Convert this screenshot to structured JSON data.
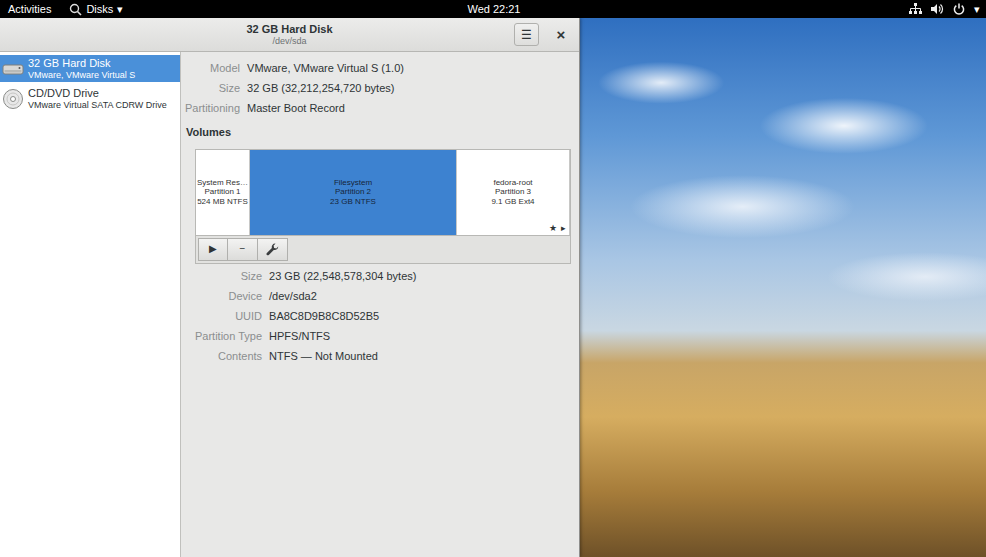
{
  "top_bar": {
    "activities": "Activities",
    "app_menu": {
      "label": "Disks",
      "arrow": "▾"
    },
    "clock": "Wed 22:21",
    "system_menu_arrow": "▾"
  },
  "window": {
    "title": "32 GB Hard Disk",
    "subtitle": "/dev/sda",
    "menu_button": "☰",
    "close_button": "×"
  },
  "sidebar": {
    "items": [
      {
        "title": "32 GB Hard Disk",
        "subtitle": "VMware, VMware Virtual S",
        "kind": "disk",
        "selected": true
      },
      {
        "title": "CD/DVD Drive",
        "subtitle": "VMware Virtual SATA CDRW Drive",
        "kind": "optical",
        "selected": false
      }
    ]
  },
  "drive_properties": [
    {
      "label": "Model",
      "value": "VMware, VMware Virtual S (1.0)"
    },
    {
      "label": "Size",
      "value": "32 GB (32,212,254,720 bytes)"
    },
    {
      "label": "Partitioning",
      "value": "Master Boot Record"
    }
  ],
  "volumes": {
    "heading": "Volumes",
    "partitions": [
      {
        "name": "System Res…",
        "number": "Partition 1",
        "size": "524 MB NTFS",
        "selected": false
      },
      {
        "name": "Filesystem",
        "number": "Partition 2",
        "size": "23 GB NTFS",
        "selected": true
      },
      {
        "name": "fedora-root",
        "number": "Partition 3",
        "size": "9.1 GB Ext4",
        "selected": false
      }
    ],
    "markers": [
      "★",
      "▸"
    ],
    "toolbar": [
      {
        "kind": "text",
        "label": "▶"
      },
      {
        "kind": "text",
        "label": "−"
      },
      {
        "kind": "wrench"
      }
    ]
  },
  "volume_properties": [
    {
      "label": "Size",
      "value": "23 GB (22,548,578,304 bytes)"
    },
    {
      "label": "Device",
      "value": "/dev/sda2"
    },
    {
      "label": "UUID",
      "value": "BA8C8D9B8C8D52B5"
    },
    {
      "label": "Partition Type",
      "value": "HPFS/NTFS"
    },
    {
      "label": "Contents",
      "value": "NTFS — Not Mounted"
    }
  ]
}
